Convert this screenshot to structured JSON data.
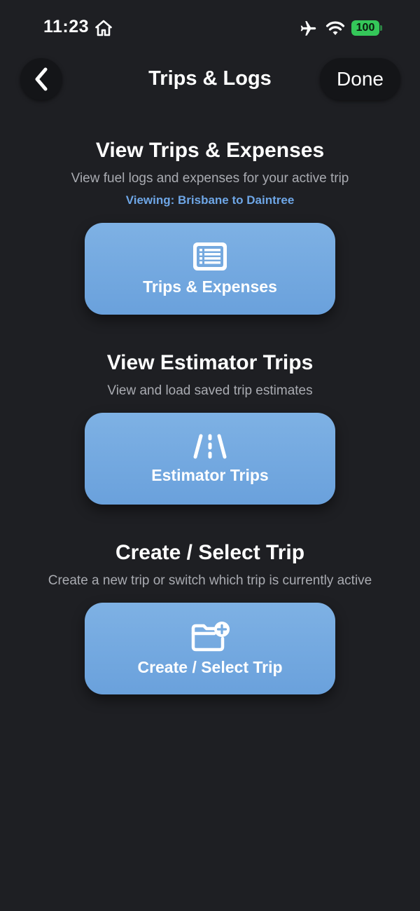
{
  "status_bar": {
    "time": "11:23",
    "battery_level": "100",
    "icons": [
      "home-icon",
      "airplane-icon",
      "wifi-icon",
      "battery-icon"
    ]
  },
  "nav": {
    "title": "Trips & Logs",
    "done_label": "Done",
    "back_icon": "chevron-left-icon"
  },
  "sections": [
    {
      "title": "View Trips & Expenses",
      "subtitle": "View fuel logs and expenses for your active trip",
      "viewing": "Viewing: Brisbane to Daintree",
      "button_label": "Trips & Expenses",
      "button_icon": "list-icon"
    },
    {
      "title": "View Estimator Trips",
      "subtitle": "View and load saved trip estimates",
      "button_label": "Estimator Trips",
      "button_icon": "road-icon"
    },
    {
      "title": "Create / Select Trip",
      "subtitle": "Create a new trip or switch which trip is currently active",
      "button_label": "Create / Select Trip",
      "button_icon": "folder-add-icon"
    }
  ],
  "colors": {
    "background": "#1e1f23",
    "button": "#74aae0",
    "accent_text": "#6ea6e6",
    "battery": "#34c759"
  }
}
